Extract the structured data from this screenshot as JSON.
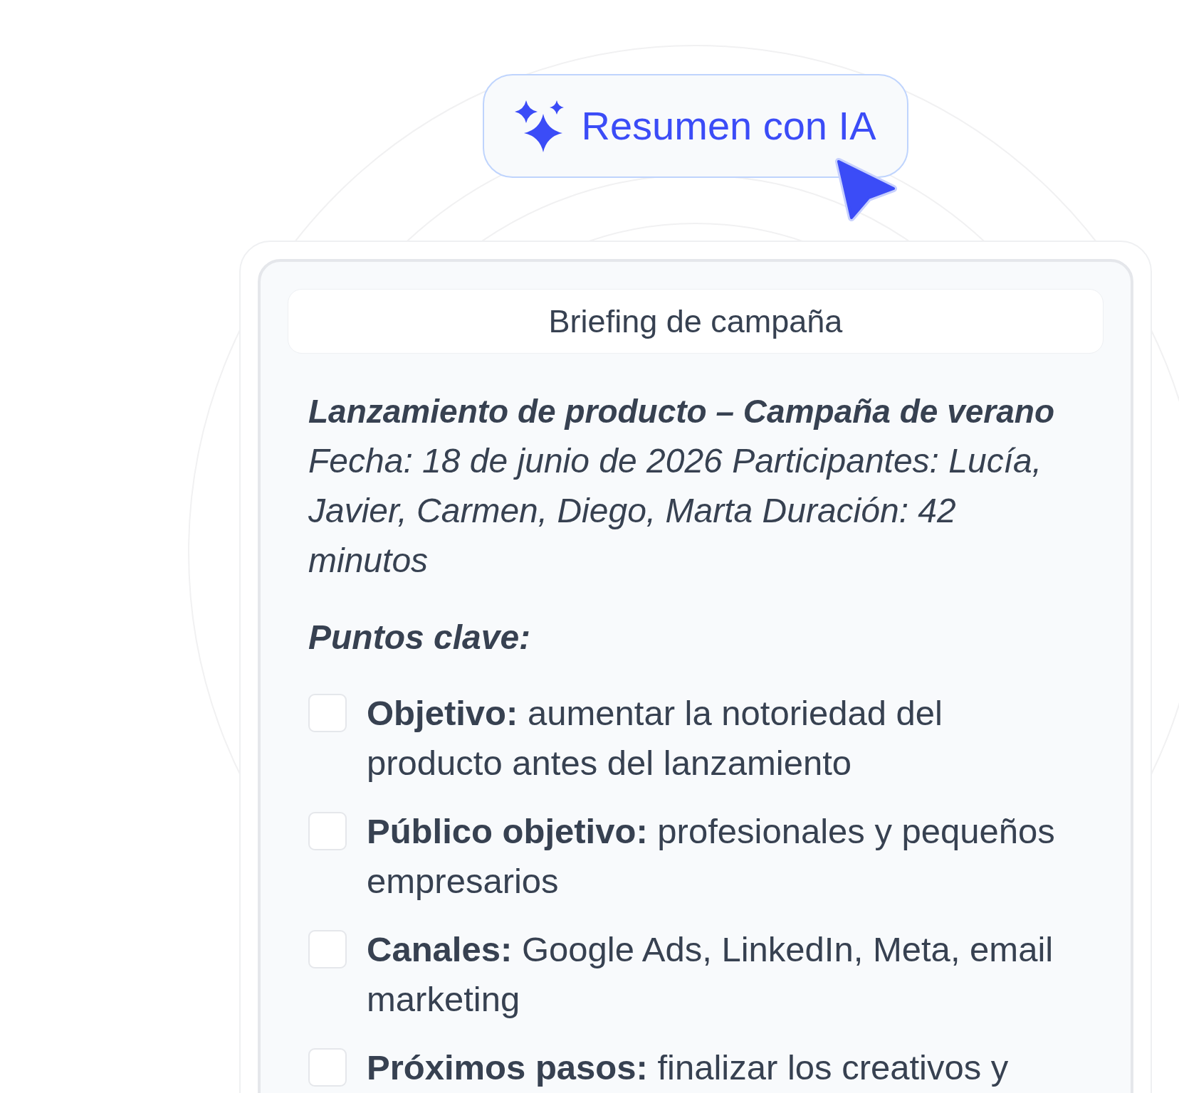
{
  "ai_button": {
    "label": "Resumen con IA"
  },
  "document": {
    "title": "Briefing de campaña",
    "heading": "Lanzamiento de producto – Campaña de verano",
    "details": "Fecha: 18 de junio de 2026 Participantes: Lucía, Javier, Carmen, Diego, Marta Duración: 42 minutos",
    "section_title": "Puntos clave:",
    "items": [
      {
        "text": "**Objetivo:** aumentar la notoriedad del producto antes del lanzamiento",
        "checked": false
      },
      {
        "text": "**Público objetivo:** profesionales y pequeños empresarios",
        "checked": false
      },
      {
        "text": "**Canales:** Google Ads, LinkedIn, Meta, email marketing",
        "checked": false
      },
      {
        "text": "**Próximos pasos:** finalizar los creativos y",
        "checked": false
      }
    ]
  }
}
